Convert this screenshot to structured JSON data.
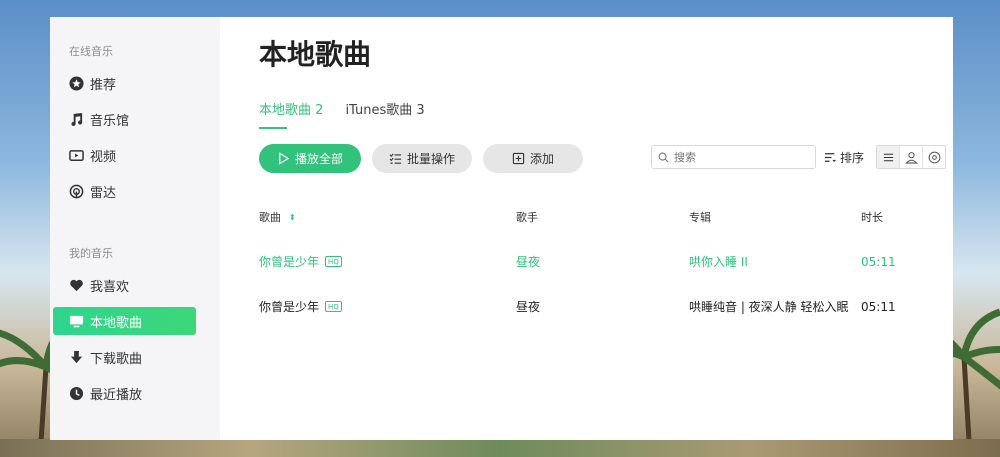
{
  "colors": {
    "accent": "#31c27c",
    "sidebar_bg": "#f5f5f7"
  },
  "sidebar": {
    "online_heading": "在线音乐",
    "online_items": [
      {
        "label": "推荐",
        "icon": "star-icon"
      },
      {
        "label": "音乐馆",
        "icon": "music-note-icon"
      },
      {
        "label": "视频",
        "icon": "video-icon"
      },
      {
        "label": "雷达",
        "icon": "radar-icon"
      }
    ],
    "mine_heading": "我的音乐",
    "mine_items": [
      {
        "label": "我喜欢",
        "icon": "heart-icon"
      },
      {
        "label": "本地歌曲",
        "icon": "monitor-icon",
        "active": true
      },
      {
        "label": "下载歌曲",
        "icon": "download-icon"
      },
      {
        "label": "最近播放",
        "icon": "clock-icon"
      }
    ]
  },
  "main": {
    "title": "本地歌曲",
    "tabs": [
      {
        "label": "本地歌曲",
        "count": "2",
        "active": true
      },
      {
        "label": "iTunes歌曲",
        "count": "3",
        "active": false
      }
    ],
    "toolbar": {
      "play_all": "播放全部",
      "batch": "批量操作",
      "add": "添加",
      "search_placeholder": "搜索",
      "sort": "排序"
    },
    "table": {
      "headers": {
        "song": "歌曲",
        "artist": "歌手",
        "album": "专辑",
        "duration": "时长"
      },
      "rows": [
        {
          "song": "你曾是少年",
          "quality": "HQ",
          "artist": "昼夜",
          "album": "哄你入睡 II",
          "duration": "05:11",
          "playing": true
        },
        {
          "song": "你曾是少年",
          "quality": "HQ",
          "artist": "昼夜",
          "album": "哄睡纯音 | 夜深人静 轻松入眠",
          "duration": "05:11",
          "playing": false
        }
      ]
    }
  }
}
